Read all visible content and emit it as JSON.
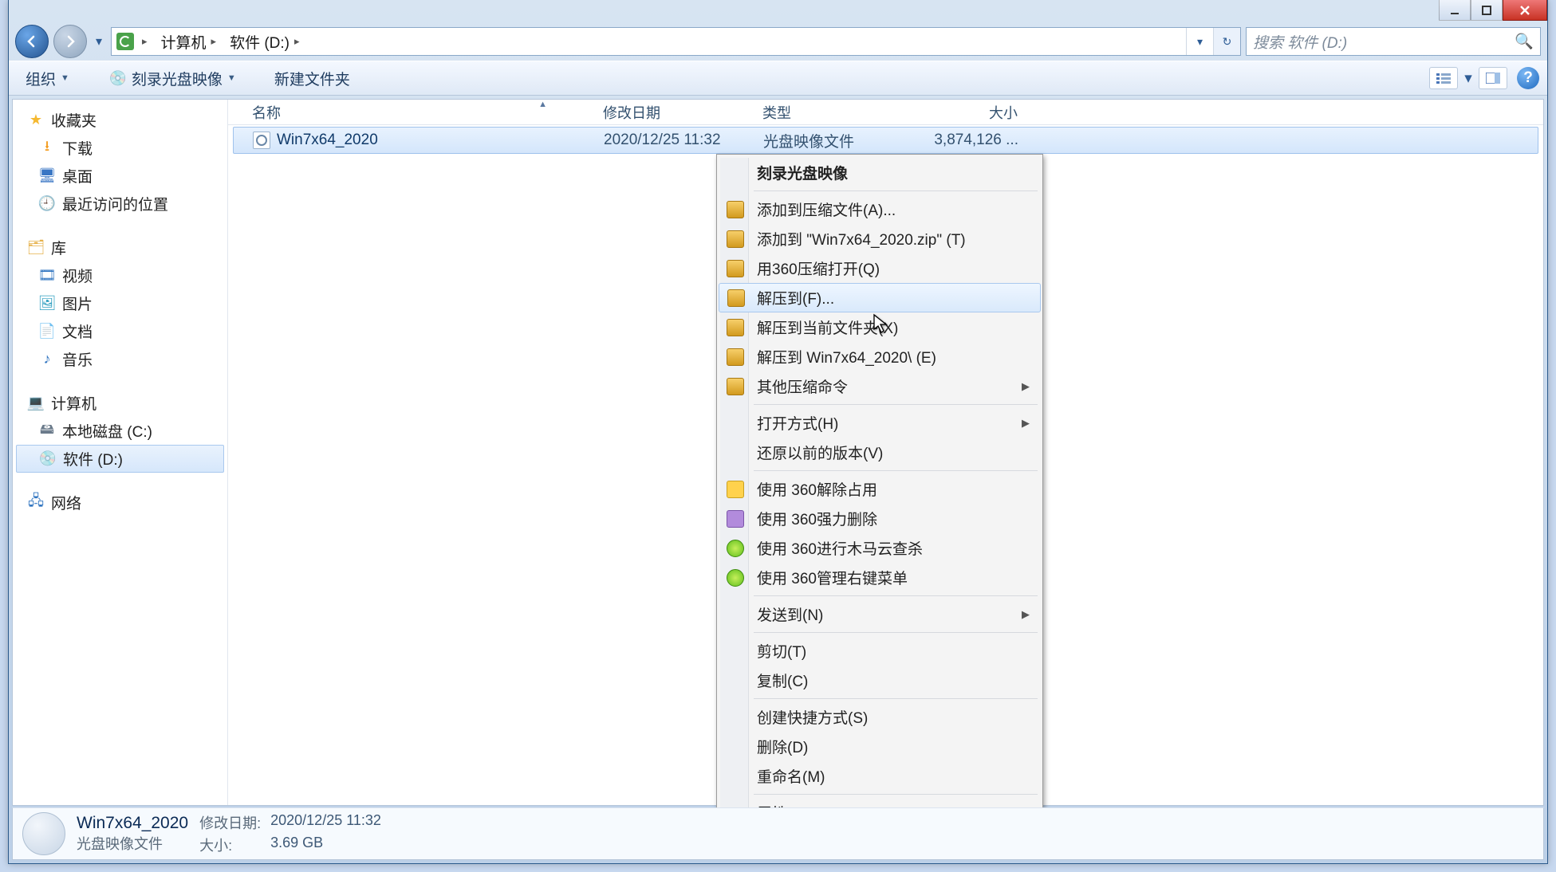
{
  "window": {
    "title": "软件 (D:)"
  },
  "nav": {
    "back_enabled": true,
    "forward_enabled": false
  },
  "address": {
    "seg1": "计算机",
    "seg2": "软件 (D:)"
  },
  "search": {
    "placeholder": "搜索 软件 (D:)"
  },
  "toolbar": {
    "organize": "组织",
    "burn": "刻录光盘映像",
    "newfolder": "新建文件夹"
  },
  "sidebar": {
    "favorites": {
      "head": "收藏夹",
      "items": [
        "下载",
        "桌面",
        "最近访问的位置"
      ]
    },
    "libraries": {
      "head": "库",
      "items": [
        "视频",
        "图片",
        "文档",
        "音乐"
      ]
    },
    "computer": {
      "head": "计算机",
      "items": [
        "本地磁盘 (C:)",
        "软件 (D:)"
      ]
    },
    "network": {
      "head": "网络"
    }
  },
  "columns": {
    "name": "名称",
    "date": "修改日期",
    "type": "类型",
    "size": "大小"
  },
  "rows": [
    {
      "name": "Win7x64_2020",
      "date": "2020/12/25 11:32",
      "type": "光盘映像文件",
      "size": "3,874,126 ..."
    }
  ],
  "context_menu": {
    "burn": "刻录光盘映像",
    "addto": "添加到压缩文件(A)...",
    "addtozip": "添加到 \"Win7x64_2020.zip\" (T)",
    "openwith360": "用360压缩打开(Q)",
    "extractto": "解压到(F)...",
    "extracthere": "解压到当前文件夹(X)",
    "extractfolder": "解压到 Win7x64_2020\\ (E)",
    "othercomp": "其他压缩命令",
    "openwith": "打开方式(H)",
    "restore": "还原以前的版本(V)",
    "u360_unlock": "使用 360解除占用",
    "u360_del": "使用 360强力删除",
    "u360_scan": "使用 360进行木马云查杀",
    "u360_menu": "使用 360管理右键菜单",
    "sendto": "发送到(N)",
    "cut": "剪切(T)",
    "copy": "复制(C)",
    "shortcut": "创建快捷方式(S)",
    "delete": "删除(D)",
    "rename": "重命名(M)",
    "properties": "属性(R)"
  },
  "details": {
    "name": "Win7x64_2020",
    "type": "光盘映像文件",
    "date_k": "修改日期:",
    "date_v": "2020/12/25 11:32",
    "size_k": "大小:",
    "size_v": "3.69 GB"
  }
}
